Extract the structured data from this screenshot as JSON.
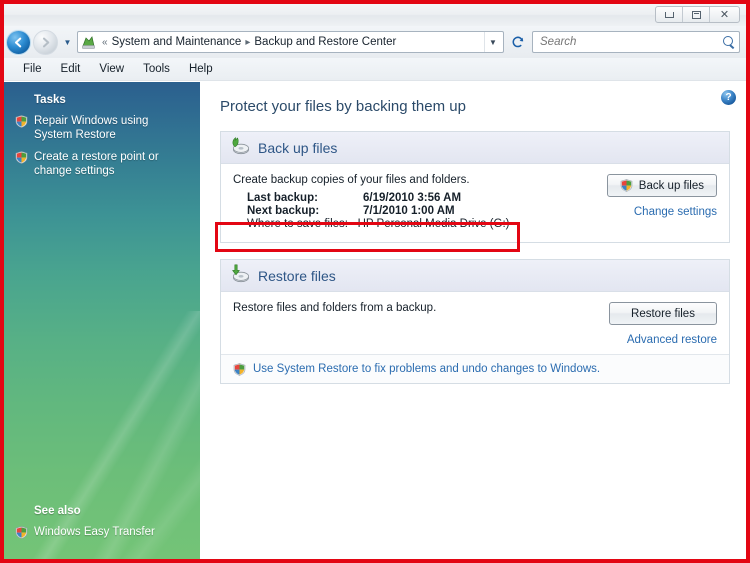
{
  "window": {
    "controls": {
      "minimize_label": "Minimize",
      "maximize_label": "Maximize",
      "close_label": "Close"
    }
  },
  "navigation": {
    "back_label": "←",
    "forward_label": "→",
    "recent_pages_label": "▼",
    "refresh_label": "↻",
    "address_dropdown_label": "▼",
    "breadcrumb_prefix": "«",
    "breadcrumb_separator": "▸",
    "breadcrumbs": [
      "System and Maintenance",
      "Backup and Restore Center"
    ],
    "search": {
      "placeholder": "Search",
      "value": ""
    }
  },
  "menubar": {
    "items": [
      "File",
      "Edit",
      "View",
      "Tools",
      "Help"
    ]
  },
  "sidebar": {
    "tasks_heading": "Tasks",
    "tasks": [
      {
        "label": "Repair Windows using System Restore",
        "icon": "shield-icon"
      },
      {
        "label": "Create a restore point or change settings",
        "icon": "shield-icon"
      }
    ],
    "see_also_heading": "See also",
    "see_also": [
      {
        "label": "Windows Easy Transfer",
        "icon": "shield-icon"
      }
    ]
  },
  "content": {
    "help_label": "?",
    "page_title": "Protect your files by backing them up",
    "backup_panel": {
      "icon": "backup-disk-icon",
      "title": "Back up files",
      "description": "Create backup copies of your files and folders.",
      "details": [
        {
          "key": "Last backup:",
          "value": "6/19/2010 3:56 AM"
        },
        {
          "key": "Next backup:",
          "value": "7/1/2010 1:00 AM"
        }
      ],
      "where_key": "Where to save files:",
      "where_value": "HP Personal Media Drive (G:)",
      "button_label": "Back up files",
      "button_icon": "uac-shield-icon",
      "link_label": "Change settings"
    },
    "restore_panel": {
      "icon": "restore-disk-icon",
      "title": "Restore files",
      "description": "Restore files and folders from a backup.",
      "button_label": "Restore files",
      "link_label": "Advanced restore",
      "footer_icon": "shield-icon",
      "footer_label": "Use System Restore to fix problems and undo changes to Windows."
    }
  },
  "annotations": [
    {
      "name": "where-to-save-files-highlight",
      "color": "#e30613"
    },
    {
      "name": "screenshot-border-highlight",
      "color": "#e30613"
    }
  ],
  "colors": {
    "annotation_red": "#e30613",
    "link_blue": "#2b6cb0",
    "panel_title_blue": "#2e5686",
    "page_title_blue": "#2b4a69",
    "sidebar_top": "#2b5f8e",
    "sidebar_bottom": "#74c477"
  }
}
